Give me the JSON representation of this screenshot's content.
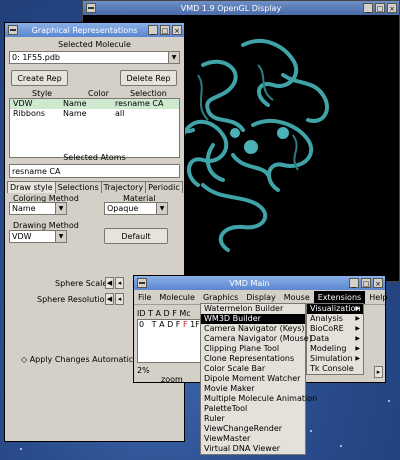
{
  "gl_window": {
    "title": "VMD 1.9 OpenGL Display"
  },
  "graphical_reps": {
    "title": "Graphical Representations",
    "selected_molecule_label": "Selected Molecule",
    "selected_molecule_value": "0: 1F55.pdb",
    "create_rep": "Create Rep",
    "delete_rep": "Delete Rep",
    "columns": [
      "Style",
      "Color",
      "Selection"
    ],
    "rows": [
      {
        "style": "VDW",
        "color": "Name",
        "selection": "resname CA"
      },
      {
        "style": "Ribbons",
        "color": "Name",
        "selection": "all"
      }
    ],
    "selected_atoms_label": "Selected Atoms",
    "selected_atoms_value": "resname CA",
    "tabs": [
      "Draw style",
      "Selections",
      "Trajectory",
      "Periodic"
    ],
    "coloring_method_label": "Coloring Method",
    "coloring_method_value": "Name",
    "material_label": "Material",
    "material_value": "Opaque",
    "drawing_method_label": "Drawing Method",
    "drawing_method_value": "VDW",
    "default_button": "Default",
    "sphere_scale_label": "Sphere Scale",
    "sphere_resolution_label": "Sphere Resolution",
    "apply_changes": "◇ Apply Changes Automatica"
  },
  "vmd_main": {
    "title": "VMD Main",
    "menus": [
      "File",
      "Molecule",
      "Graphics",
      "Display",
      "Mouse",
      "Extensions",
      "Help"
    ],
    "active_menu": "Extensions",
    "list_header": "ID T A D F Mc",
    "list_row_prefix": "0",
    "list_row_flags": "T A D F",
    "list_row_red": "F",
    "list_row_name": "1F",
    "zoom_label": "zoom",
    "frame_value": "2%"
  },
  "extensions_menu": {
    "items": [
      {
        "label": "Visualization",
        "submenu": true,
        "highlight": true
      },
      {
        "label": "Analysis",
        "submenu": true
      },
      {
        "label": "BioCoRE",
        "submenu": true
      },
      {
        "label": "Data",
        "submenu": true
      },
      {
        "label": "Modeling",
        "submenu": true
      },
      {
        "label": "Simulation",
        "submenu": true
      },
      {
        "label": "Tk Console",
        "submenu": false
      }
    ]
  },
  "visualization_menu": {
    "items": [
      {
        "label": "Watermelon Builder"
      },
      {
        "label": "WM3D Builder",
        "highlight": true
      },
      {
        "label": "Camera Navigator (Keys)"
      },
      {
        "label": "Camera Navigator (Mouse)"
      },
      {
        "label": "Clipping Plane Tool"
      },
      {
        "label": "Clone Representations"
      },
      {
        "label": "Color Scale Bar"
      },
      {
        "label": "Dipole Moment Watcher"
      },
      {
        "label": "Movie Maker"
      },
      {
        "label": "Multiple Molecule Animation"
      },
      {
        "label": "PaletteTool"
      },
      {
        "label": "Ruler"
      },
      {
        "label": "ViewChangeRender"
      },
      {
        "label": "ViewMaster"
      },
      {
        "label": "Virtual DNA Viewer"
      }
    ]
  },
  "colors": {
    "ribbon": "#3fa3a8",
    "titlebar": "#5b86cf",
    "window_bg": "#d4d0c8"
  }
}
